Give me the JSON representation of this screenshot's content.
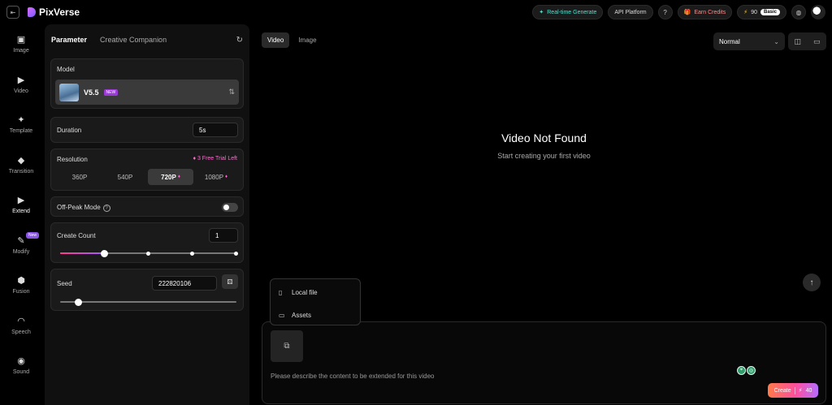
{
  "app": {
    "name": "PixVerse"
  },
  "topbar": {
    "realtime": "Real-time Generate",
    "api": "API Platform",
    "earn": "Earn Credits",
    "credits": "90",
    "plan": "Basic"
  },
  "rail": {
    "items": [
      {
        "label": "Image"
      },
      {
        "label": "Video"
      },
      {
        "label": "Template"
      },
      {
        "label": "Transition"
      },
      {
        "label": "Extend"
      },
      {
        "label": "Modify",
        "badge": "New"
      },
      {
        "label": "Fusion"
      },
      {
        "label": "Speech"
      },
      {
        "label": "Sound"
      }
    ]
  },
  "panel": {
    "tabs": [
      "Parameter",
      "Creative Companion"
    ],
    "model": {
      "label": "Model",
      "name": "V5.5",
      "tag": "NEW"
    },
    "duration": {
      "label": "Duration",
      "value": "5s"
    },
    "resolution": {
      "label": "Resolution",
      "trial": "3 Free Trial Left",
      "options": [
        "360P",
        "540P",
        "720P",
        "1080P"
      ],
      "selected": "720P"
    },
    "offpeak": {
      "label": "Off-Peak Mode",
      "enabled": false
    },
    "create_count": {
      "label": "Create Count",
      "value": "1",
      "min": 1,
      "max": 4
    },
    "seed": {
      "label": "Seed",
      "value": "222820106",
      "slider_fraction": 0.1
    }
  },
  "main": {
    "tabs": [
      "Video",
      "Image"
    ],
    "quality": "Normal",
    "empty_title": "Video Not Found",
    "empty_sub": "Start creating your first video",
    "upload_menu": [
      "Local file",
      "Assets"
    ],
    "prompt_placeholder": "Please describe the content to be extended for this video",
    "create_label": "Create",
    "create_cost": "40"
  },
  "colors": {
    "accent_pink": "#ff6bd0",
    "accent_teal": "#4fe0d0",
    "create_start": "#ff7a4a",
    "create_end": "#b66dff"
  }
}
